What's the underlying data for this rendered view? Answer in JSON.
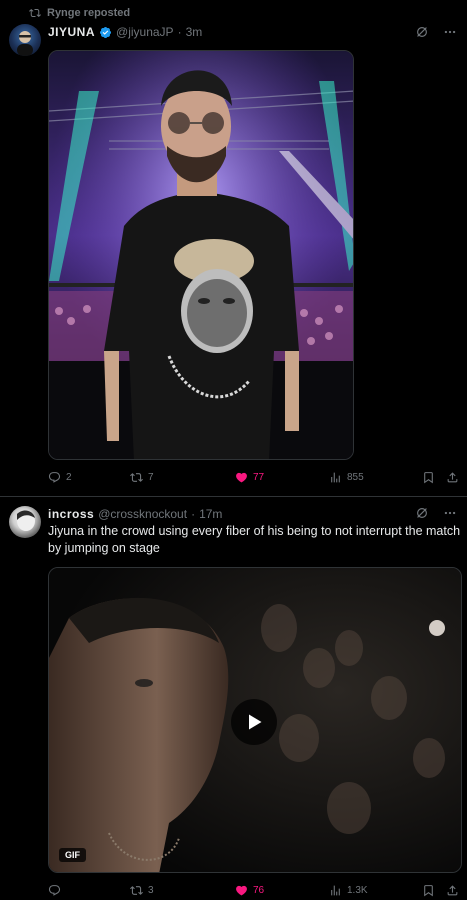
{
  "tweets": [
    {
      "repost_by": "Rynge reposted",
      "name": "JIYUNA",
      "handle": "@jiyunaJP",
      "dot": "·",
      "time": "3m",
      "text": "",
      "media_type": "photo",
      "stats": {
        "replies": "2",
        "reposts": "7",
        "likes": "77",
        "views": "855"
      },
      "liked": true
    },
    {
      "repost_by": "",
      "name": "incross",
      "handle": "@crossknockout",
      "dot": "·",
      "time": "17m",
      "text": "Jiyuna in the crowd using every fiber of his being to not  interrupt the match by jumping on stage",
      "media_type": "gif",
      "media_badge": "GIF",
      "stats": {
        "replies": "",
        "reposts": "3",
        "likes": "76",
        "views": "1.3K"
      },
      "liked": true
    }
  ],
  "colors": {
    "background": "#000000",
    "text": "#e7e9ea",
    "muted": "#71767b",
    "like": "#f91880",
    "verified": "#1d9bf0",
    "divider": "#2f3336"
  },
  "icons": [
    "repost-icon",
    "verified-badge-icon",
    "grok-icon",
    "more-icon",
    "reply-icon",
    "like-icon",
    "views-icon",
    "bookmark-icon",
    "share-icon",
    "play-icon"
  ]
}
